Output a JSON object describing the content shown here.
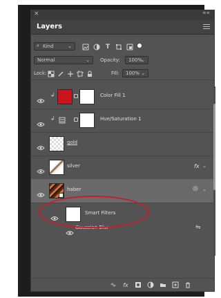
{
  "panel": {
    "close_glyph": "×",
    "collapse_glyph": "««",
    "tab_label": "Layers",
    "filter": {
      "kind_label": "Kind",
      "icons": [
        "image-filter-icon",
        "adjustment-filter-icon",
        "type-filter-icon",
        "shape-filter-icon",
        "smart-object-filter-icon",
        "filter-toggle-icon"
      ]
    },
    "blend": {
      "mode_value": "Normal",
      "opacity_label": "Opacity:",
      "opacity_value": "100%"
    },
    "lock": {
      "label": "Lock:",
      "fill_label": "Fill:",
      "fill_value": "100%"
    }
  },
  "layers": [
    {
      "name": "Color Fill 1",
      "thumb_color": "#c8141c",
      "has_mask": true
    },
    {
      "name": "Hue/Saturation 1",
      "has_mask": true
    },
    {
      "name": "gold",
      "underline": true
    },
    {
      "name": "silver",
      "fx": "fx"
    },
    {
      "name": "haber",
      "selected": true
    },
    {
      "name": "Smart Filters",
      "has_mask": true
    },
    {
      "name": "Gaussian Blur"
    }
  ],
  "colors": {
    "panel_bg": "#535353",
    "selected_row": "#6a6a6a",
    "highlight_ellipse": "#c71e2c"
  },
  "bottom_toolbar": {
    "fx_label": "fx",
    "icons": [
      "link-layers-icon",
      "add-style-icon",
      "add-mask-icon",
      "new-adjustment-icon",
      "new-group-icon",
      "new-layer-icon",
      "delete-layer-icon"
    ]
  }
}
